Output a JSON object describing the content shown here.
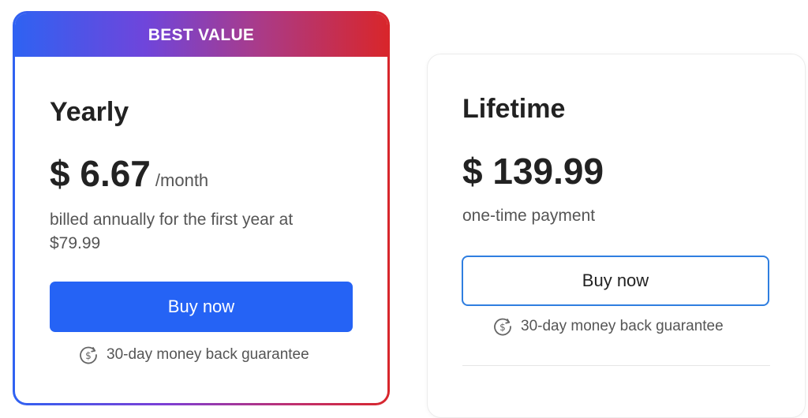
{
  "yearly": {
    "banner": "BEST VALUE",
    "name": "Yearly",
    "price": "$ 6.67",
    "per": "/month",
    "note": "billed annually for the first year at $79.99",
    "button": "Buy now",
    "guarantee": "30-day money back guarantee"
  },
  "lifetime": {
    "name": "Lifetime",
    "price": "$ 139.99",
    "note": "one-time payment",
    "button": "Buy now",
    "guarantee": "30-day money back guarantee"
  },
  "colors": {
    "accent_blue": "#2563f5",
    "gradient_start": "#2f62f2",
    "gradient_end": "#d8262b",
    "outline_border": "#2f7ee0"
  },
  "icons": {
    "guarantee": "money-back-icon"
  }
}
